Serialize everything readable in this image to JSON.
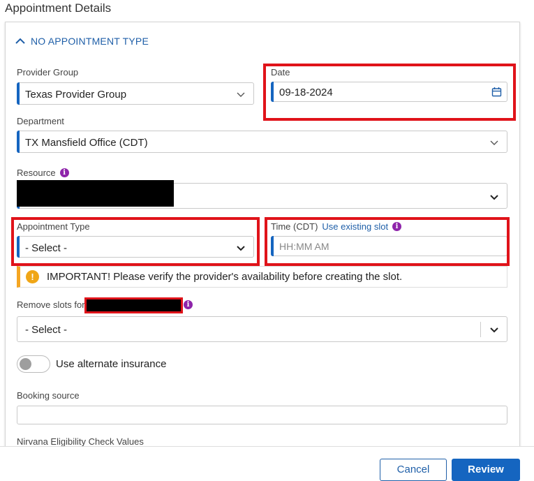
{
  "page": {
    "title": "Appointment Details"
  },
  "section": {
    "header": "NO APPOINTMENT TYPE"
  },
  "provider_group": {
    "label": "Provider Group",
    "value": "Texas Provider Group"
  },
  "date": {
    "label": "Date",
    "value": "09-18-2024"
  },
  "department": {
    "label": "Department",
    "value": "TX Mansfield Office (CDT)"
  },
  "resource": {
    "label": "Resource",
    "value": ""
  },
  "appointment_type": {
    "label": "Appointment Type",
    "value": "- Select -"
  },
  "time": {
    "label": "Time (CDT)",
    "link": "Use existing slot",
    "placeholder": "HH:MM AM"
  },
  "banner": {
    "icon": "warning-icon",
    "text": "IMPORTANT! Please verify the provider's availability before creating the slot."
  },
  "remove_slots": {
    "label": "Remove slots for",
    "value": "- Select -"
  },
  "alternate_insurance": {
    "label": "Use alternate insurance",
    "on": false
  },
  "booking_source": {
    "label": "Booking source",
    "value": ""
  },
  "nirvana": {
    "label": "Nirvana Eligibility Check Values"
  },
  "footer": {
    "cancel_label": "Cancel",
    "review_label": "Review"
  },
  "colors": {
    "accent": "#1565c0",
    "highlight": "#e0131a",
    "warning": "#f0a616",
    "info": "#8e24aa"
  }
}
